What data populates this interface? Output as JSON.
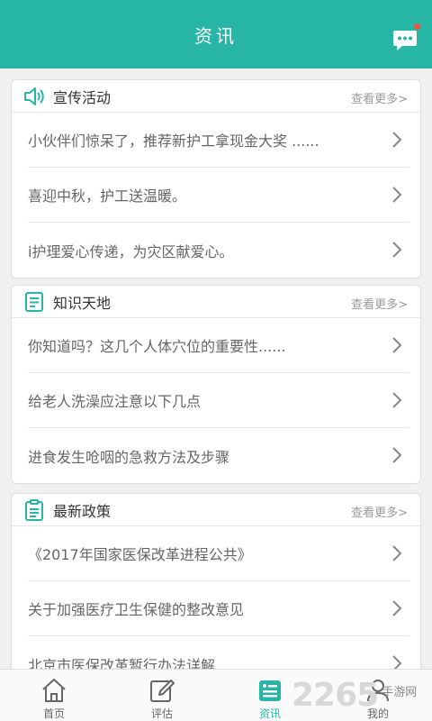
{
  "header": {
    "title": "资讯",
    "message_icon": "chat-bubble-icon",
    "accent": "#27b6a6"
  },
  "sections": [
    {
      "title": "宣传活动",
      "icon": "speaker-icon",
      "more": "查看更多>",
      "items": [
        "小伙伴们惊呆了，推荐新护工拿现金大奖 ......",
        "喜迎中秋，护工送温暖。",
        "i护理爱心传递，为灾区献爱心。"
      ]
    },
    {
      "title": "知识天地",
      "icon": "document-icon",
      "more": "查看更多>",
      "items": [
        "你知道吗？这几个人体穴位的重要性......",
        "给老人洗澡应注意以下几点",
        "进食发生呛咽的急救方法及步骤"
      ]
    },
    {
      "title": "最新政策",
      "icon": "clipboard-icon",
      "more": "查看更多>",
      "items": [
        "《2017年国家医保改革进程公共》",
        "关于加强医疗卫生保健的整改意见",
        "北京市医保改革暂行办法详解"
      ]
    }
  ],
  "tabbar": {
    "items": [
      {
        "label": "首页",
        "icon": "home-icon",
        "active": false
      },
      {
        "label": "评估",
        "icon": "edit-icon",
        "active": false
      },
      {
        "label": "资讯",
        "icon": "news-list-icon",
        "active": true
      },
      {
        "label": "我的",
        "icon": "user-icon",
        "active": false
      }
    ]
  },
  "watermark": {
    "number": "2265",
    "text": "手游网"
  }
}
